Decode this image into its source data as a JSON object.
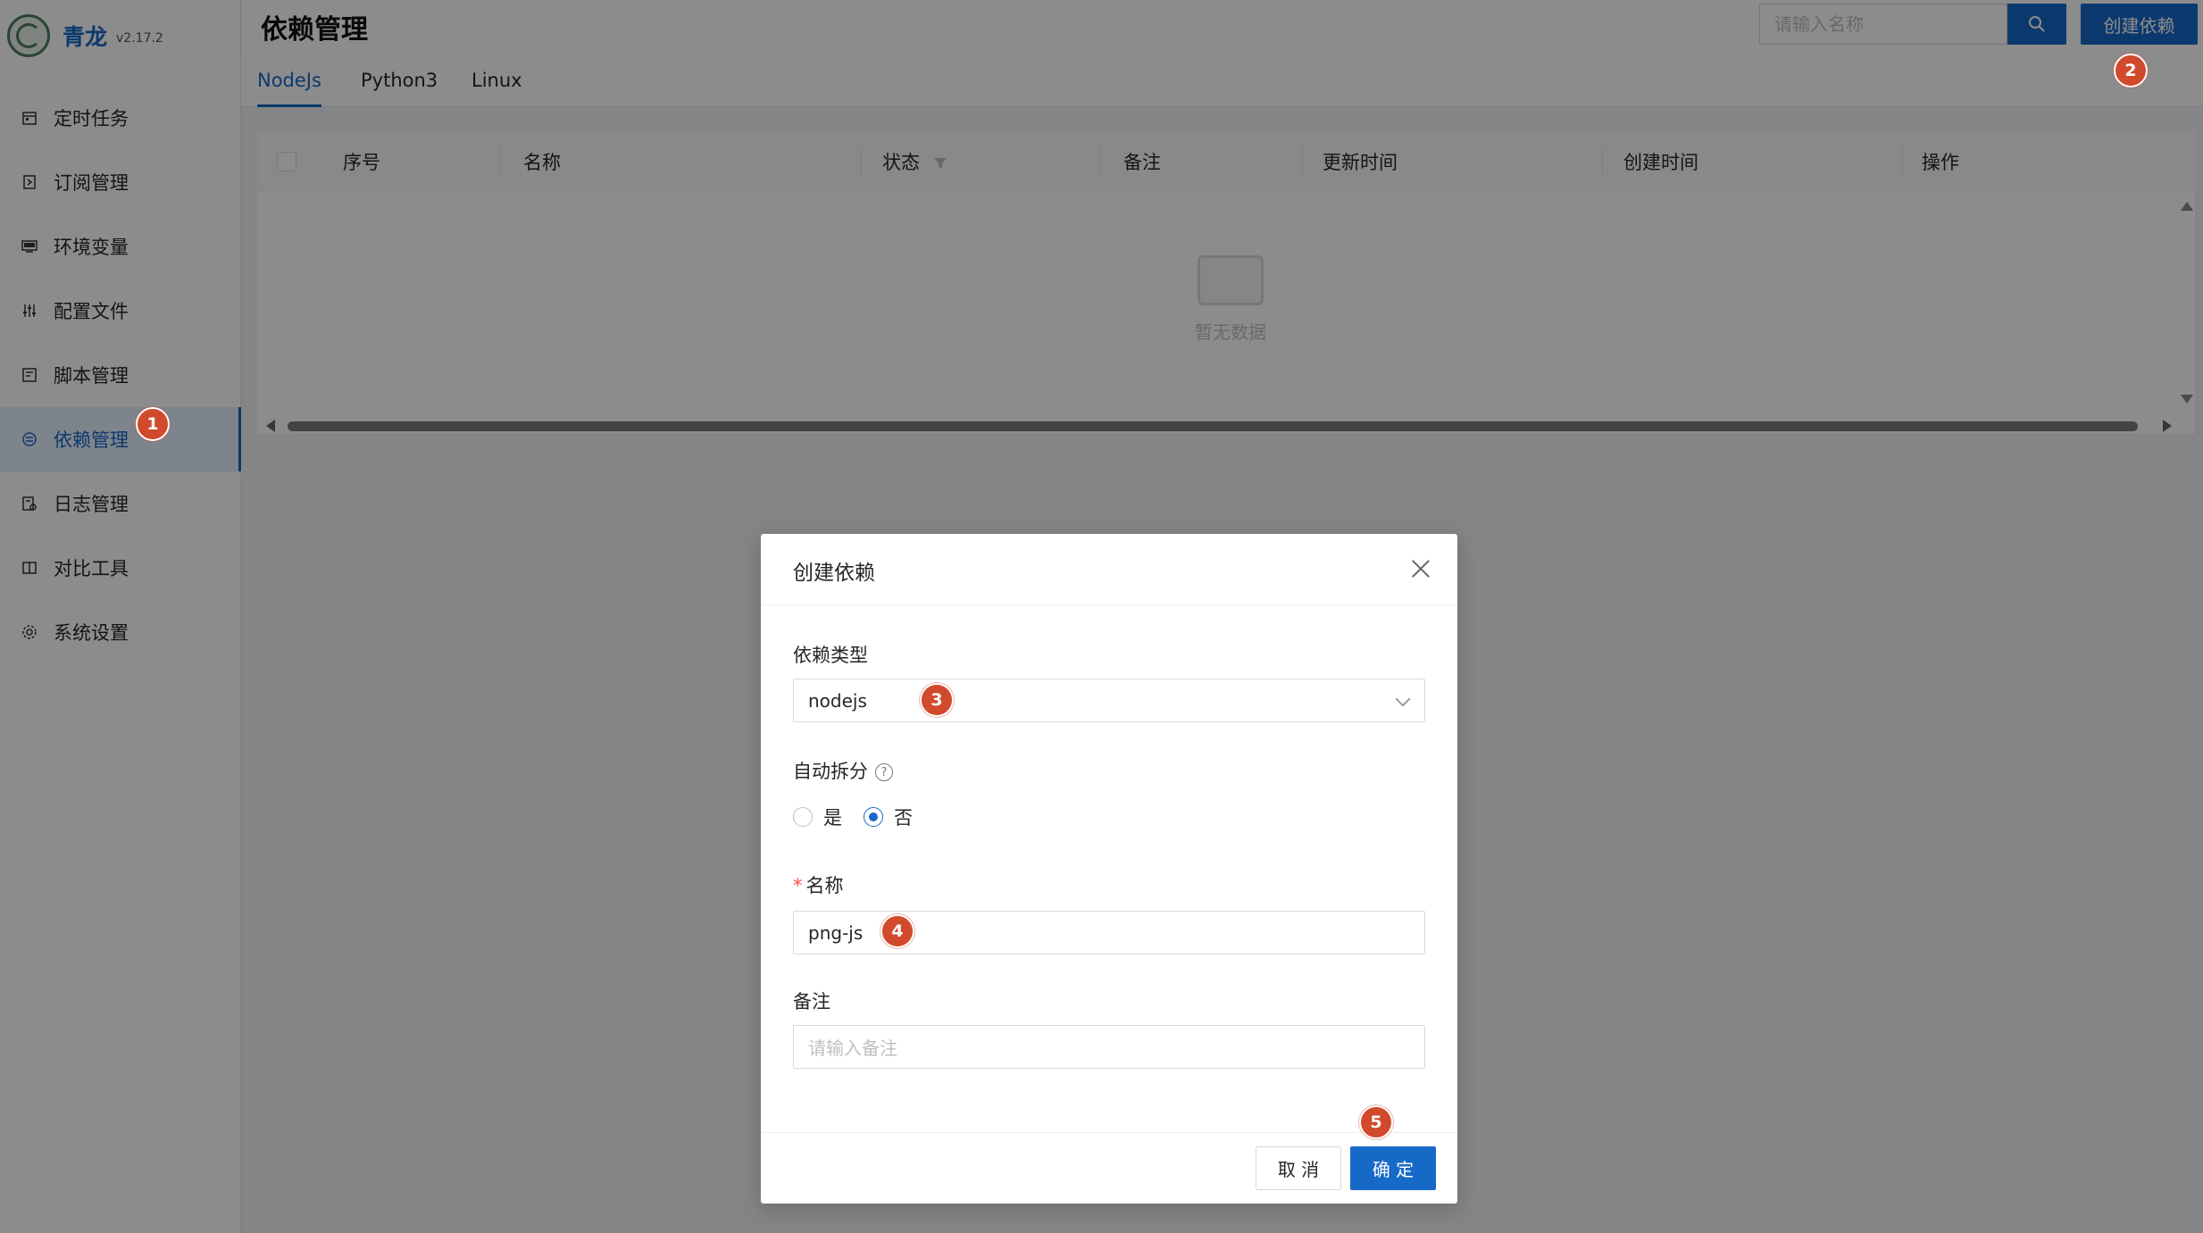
{
  "app": {
    "name": "青龙",
    "version": "v2.17.2"
  },
  "sidebar": {
    "items": [
      {
        "label": "定时任务",
        "icon": "calendar-icon"
      },
      {
        "label": "订阅管理",
        "icon": "subscription-icon"
      },
      {
        "label": "环境变量",
        "icon": "environment-icon"
      },
      {
        "label": "配置文件",
        "icon": "sliders-icon"
      },
      {
        "label": "脚本管理",
        "icon": "script-icon"
      },
      {
        "label": "依赖管理",
        "icon": "dependency-icon",
        "active": true
      },
      {
        "label": "日志管理",
        "icon": "log-icon"
      },
      {
        "label": "对比工具",
        "icon": "diff-icon"
      },
      {
        "label": "系统设置",
        "icon": "gear-icon"
      }
    ]
  },
  "header": {
    "title": "依赖管理",
    "search_placeholder": "请输入名称",
    "create_label": "创建依赖"
  },
  "tabs": [
    {
      "label": "NodeJs",
      "active": true
    },
    {
      "label": "Python3"
    },
    {
      "label": "Linux"
    }
  ],
  "table": {
    "columns": [
      "序号",
      "名称",
      "状态",
      "备注",
      "更新时间",
      "创建时间",
      "操作"
    ],
    "empty_text": "暂无数据"
  },
  "modal": {
    "title": "创建依赖",
    "type_label": "依赖类型",
    "type_value": "nodejs",
    "auto_split_label": "自动拆分",
    "auto_split_options": [
      "是",
      "否"
    ],
    "auto_split_selected": "否",
    "name_required_mark": "*",
    "name_label": "名称",
    "name_value": "png-js",
    "remark_label": "备注",
    "remark_placeholder": "请输入备注",
    "cancel_label": "取 消",
    "ok_label": "确 定"
  },
  "markers": [
    "1",
    "2",
    "3",
    "4",
    "5"
  ],
  "colors": {
    "primary": "#1769c7",
    "marker": "#d04a2b",
    "overlay": "rgba(0,0,0,0.45)"
  }
}
